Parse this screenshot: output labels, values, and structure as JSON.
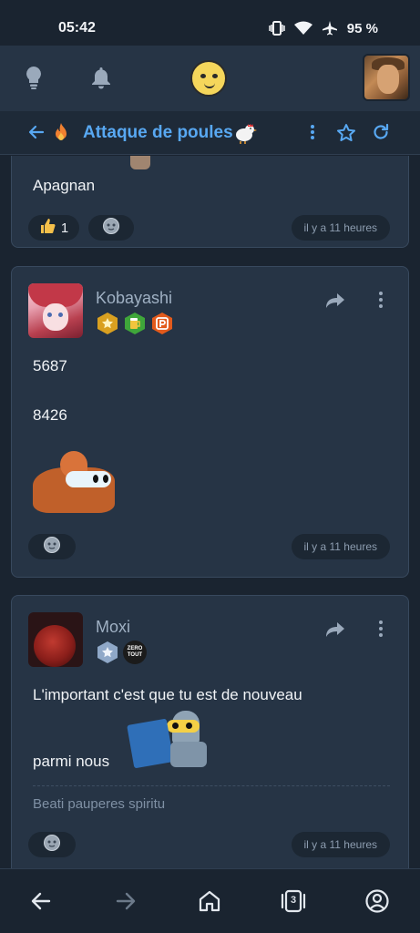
{
  "status": {
    "time": "05:42",
    "battery": "95 %"
  },
  "topbar": {
    "icons": [
      "lightbulb-icon",
      "bell-icon",
      "smiley-logo",
      "user-avatar"
    ]
  },
  "subbar": {
    "title": "Attaque de poules",
    "accent": "#58a8f2"
  },
  "posts": [
    {
      "text": "Apagnan",
      "reactions": [
        {
          "emoji": "thumbs-up",
          "count": "1"
        }
      ],
      "time": "il y a 11 heures"
    },
    {
      "user": "Kobayashi",
      "lines": [
        "5687",
        "8426"
      ],
      "time": "il y a 11 heures"
    },
    {
      "user": "Moxi",
      "line1": "L'important c'est que tu est de nouveau",
      "line2": "parmi nous",
      "badge_text": [
        "ZERO",
        "TOUT"
      ],
      "signature": "Beati pauperes spiritu",
      "time": "il y a 11 heures"
    }
  ],
  "nav": {
    "tab_count": "3"
  }
}
